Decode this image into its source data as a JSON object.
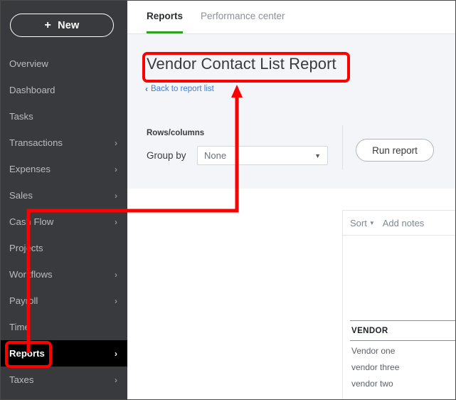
{
  "sidebar": {
    "new_button": {
      "label": "New",
      "icon": "plus-icon"
    },
    "items": [
      {
        "label": "Overview",
        "has_chevron": false,
        "active": false
      },
      {
        "label": "Dashboard",
        "has_chevron": false,
        "active": false
      },
      {
        "label": "Tasks",
        "has_chevron": false,
        "active": false
      },
      {
        "label": "Transactions",
        "has_chevron": true,
        "active": false
      },
      {
        "label": "Expenses",
        "has_chevron": true,
        "active": false
      },
      {
        "label": "Sales",
        "has_chevron": true,
        "active": false
      },
      {
        "label": "Cash Flow",
        "has_chevron": true,
        "active": false
      },
      {
        "label": "Projects",
        "has_chevron": false,
        "active": false
      },
      {
        "label": "Workflows",
        "has_chevron": true,
        "active": false
      },
      {
        "label": "Payroll",
        "has_chevron": true,
        "active": false
      },
      {
        "label": "Time",
        "has_chevron": false,
        "active": false
      },
      {
        "label": "Reports",
        "has_chevron": true,
        "active": true
      },
      {
        "label": "Taxes",
        "has_chevron": true,
        "active": false
      }
    ],
    "chevron_glyph": "›"
  },
  "tabs": [
    {
      "label": "Reports",
      "active": true
    },
    {
      "label": "Performance center",
      "active": false
    }
  ],
  "report": {
    "title": "Vendor Contact List Report",
    "back_link": "Back to report list",
    "back_chevron": "‹"
  },
  "controls": {
    "rows_columns_label": "Rows/columns",
    "group_by_label": "Group by",
    "group_by_value": "None",
    "caret_glyph": "▼",
    "run_report_label": "Run report"
  },
  "preview": {
    "sort_label": "Sort",
    "sort_caret": "▼",
    "add_notes_label": "Add notes",
    "table": {
      "header": "VENDOR",
      "rows": [
        "Vendor one",
        "vendor three",
        "vendor two"
      ]
    }
  },
  "annotations": {
    "highlight_color": "#ff0000",
    "title_box": {
      "label": "title-highlight"
    },
    "reports_box": {
      "label": "reports-menu-highlight"
    },
    "arrow": {
      "label": "arrow-from-reports-to-title"
    }
  },
  "colors": {
    "sidebar_bg": "#393a3d",
    "active_item_bg": "#000000",
    "accent_green": "#2ca01c",
    "link_blue": "#3d7ddd",
    "panel_bg": "#f4f5f8"
  }
}
